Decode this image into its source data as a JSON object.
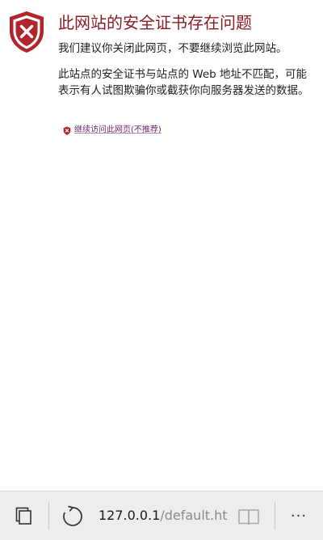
{
  "error": {
    "title": "此网站的安全证书存在问题",
    "advice": "我们建议你关闭此网页，不要继续浏览此网站。",
    "detail": "此站点的安全证书与站点的 Web 地址不匹配，可能表示有人试图欺骗你或截获你向服务器发送的数据。",
    "continue_link": "继续访问此网页(不推荐)"
  },
  "toolbar": {
    "address_host": "127.0.0.1",
    "address_path": "/default.ht",
    "more_label": "···",
    "icons": {
      "tabs": "tabs-icon",
      "refresh": "refresh-icon",
      "reading": "reading-view-icon",
      "more": "more-icon"
    }
  },
  "colors": {
    "shield": "#b0262c",
    "title": "#8c1c23",
    "link": "#6b2a6e",
    "toolbar_bg": "#ededed"
  }
}
